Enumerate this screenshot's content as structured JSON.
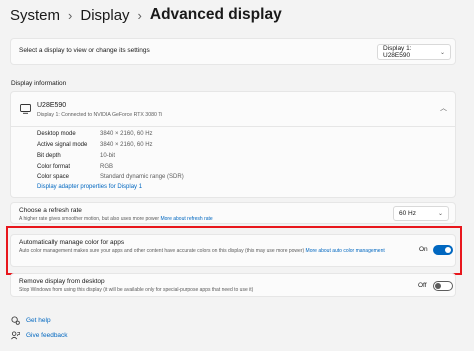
{
  "breadcrumb": {
    "items": [
      "System",
      "Display"
    ],
    "current": "Advanced display",
    "separator": "›"
  },
  "display_select": {
    "label": "Select a display to view or change its settings",
    "value": "Display 1: U28E590"
  },
  "display_info": {
    "section_title": "Display information",
    "name": "U28E590",
    "subtitle": "Display 1: Connected to NVIDIA GeForce RTX 3080 Ti",
    "specs": [
      {
        "key": "Desktop mode",
        "value": "3840 × 2160, 60 Hz"
      },
      {
        "key": "Active signal mode",
        "value": "3840 × 2160, 60 Hz"
      },
      {
        "key": "Bit depth",
        "value": "10-bit"
      },
      {
        "key": "Color format",
        "value": "RGB"
      },
      {
        "key": "Color space",
        "value": "Standard dynamic range (SDR)"
      }
    ],
    "adapter_link": "Display adapter properties for Display 1"
  },
  "refresh_rate": {
    "title": "Choose a refresh rate",
    "subtitle": "A higher rate gives smoother motion, but also uses more power",
    "link": "More about refresh rate",
    "value": "60 Hz"
  },
  "auto_color": {
    "title": "Automatically manage color for apps",
    "subtitle": "Auto color management makes sure your apps and other content have accurate colors on this display (this may use more power)",
    "link": "More about auto color management",
    "state_label": "On",
    "state": true
  },
  "remove_display": {
    "title": "Remove display from desktop",
    "subtitle": "Stop Windows from using this display (it will be available only for special-purpose apps that need to use it)",
    "state_label": "Off",
    "state": false
  },
  "footer": {
    "get_help": "Get help",
    "give_feedback": "Give feedback"
  },
  "colors": {
    "accent": "#0067c0",
    "highlight": "#e8161c",
    "background": "#f3f3f3",
    "card": "#fbfbfb"
  },
  "icons": {
    "display": "monitor-icon",
    "help": "help-icon",
    "feedback": "feedback-icon"
  }
}
